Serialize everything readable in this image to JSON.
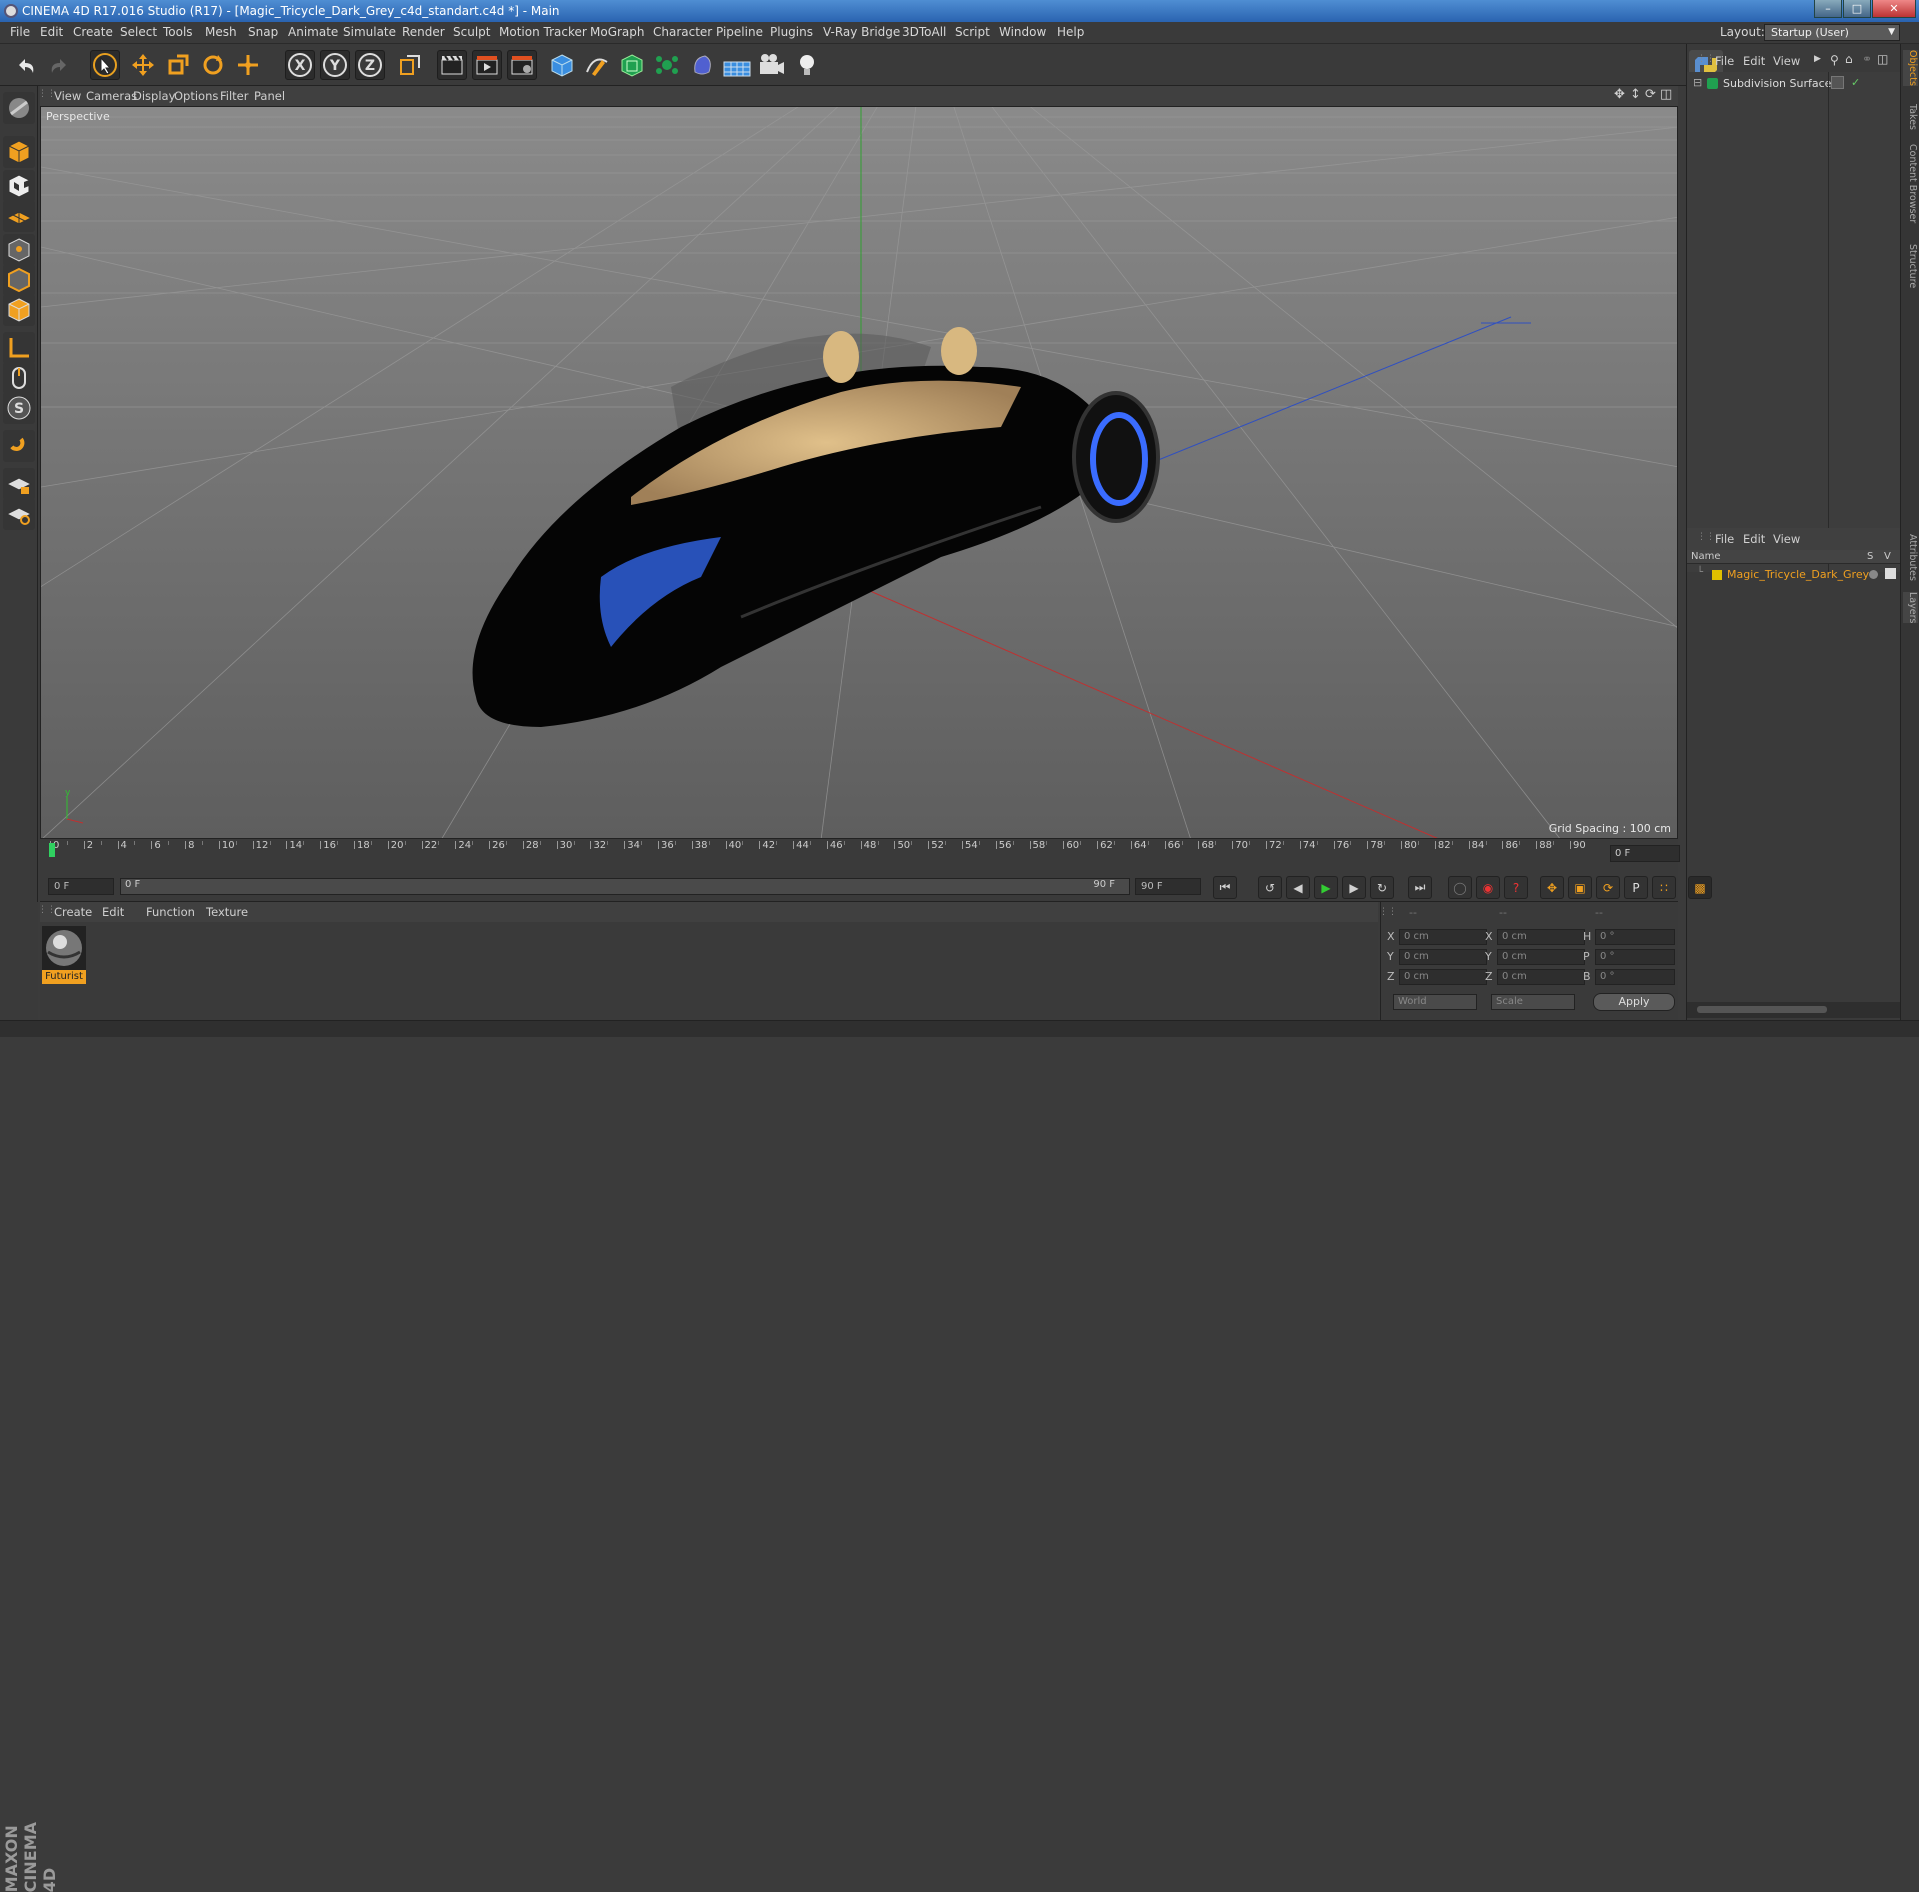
{
  "window": {
    "title": "CINEMA 4D R17.016 Studio (R17) - [Magic_Tricycle_Dark_Grey_c4d_standart.c4d *] - Main"
  },
  "menubar": {
    "items": [
      "File",
      "Edit",
      "Create",
      "Select",
      "Tools",
      "Mesh",
      "Snap",
      "Animate",
      "Simulate",
      "Render",
      "Sculpt",
      "Motion Tracker",
      "MoGraph",
      "Character",
      "Pipeline",
      "Plugins",
      "V-Ray Bridge",
      "3DToAll",
      "Script",
      "Window",
      "Help"
    ],
    "layout_label": "Layout:",
    "layout_value": "Startup (User)"
  },
  "viewport": {
    "menu": [
      "View",
      "Cameras",
      "Display",
      "Options",
      "Filter",
      "Panel"
    ],
    "label": "Perspective",
    "grid_spacing": "Grid Spacing : 100 cm"
  },
  "timeline": {
    "ticks": [
      "0",
      "2",
      "4",
      "6",
      "8",
      "10",
      "12",
      "14",
      "16",
      "18",
      "20",
      "22",
      "24",
      "26",
      "28",
      "30",
      "32",
      "34",
      "36",
      "38",
      "40",
      "42",
      "44",
      "46",
      "48",
      "50",
      "52",
      "54",
      "56",
      "58",
      "60",
      "62",
      "64",
      "66",
      "68",
      "70",
      "72",
      "74",
      "76",
      "78",
      "80",
      "82",
      "84",
      "86",
      "88",
      "90"
    ],
    "current_frame": "0 F"
  },
  "playbar": {
    "start": "0 F",
    "range_start": "0 F",
    "range_end": "90 F",
    "end": "90 F"
  },
  "materials": {
    "menu": [
      "Create",
      "Edit",
      "Function",
      "Texture"
    ],
    "items": [
      {
        "name": "Futurist"
      }
    ]
  },
  "coords": {
    "headers": [
      "--",
      "--",
      "--"
    ],
    "rows": [
      {
        "a": "X",
        "av": "0 cm",
        "b": "X",
        "bv": "0 cm",
        "c": "H",
        "cv": "0 °"
      },
      {
        "a": "Y",
        "av": "0 cm",
        "b": "Y",
        "bv": "0 cm",
        "c": "P",
        "cv": "0 °"
      },
      {
        "a": "Z",
        "av": "0 cm",
        "b": "Z",
        "bv": "0 cm",
        "c": "B",
        "cv": "0 °"
      }
    ],
    "mode1": "World",
    "mode2": "Scale",
    "apply": "Apply"
  },
  "objects": {
    "menu": [
      "File",
      "Edit",
      "View"
    ],
    "items": [
      {
        "name": "Subdivision Surface"
      }
    ]
  },
  "layers": {
    "menu": [
      "File",
      "Edit",
      "View"
    ],
    "col_name": "Name",
    "col_s": "S",
    "col_v": "V",
    "items": [
      {
        "name": "Magic_Tricycle_Dark_Grey"
      }
    ]
  },
  "side_tabs": [
    "Objects",
    "Takes",
    "Content Browser",
    "Structure",
    "Attributes",
    "Layers"
  ],
  "branding": "MAXON CINEMA 4D",
  "colors": {
    "accent": "#2a63b0",
    "axis_x": "#c03030",
    "axis_y": "#30a030",
    "axis_z": "#3050c0",
    "tire_glow": "#3a6cff",
    "layer_yellow": "#e0c000"
  }
}
